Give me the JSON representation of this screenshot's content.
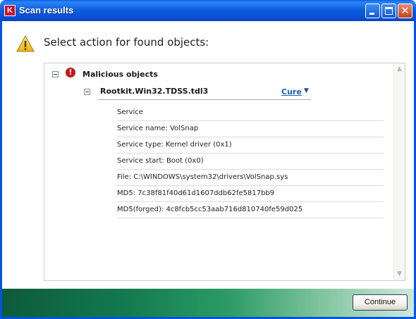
{
  "window": {
    "title": "Scan results",
    "app_icon": "kaspersky-k-icon",
    "controls": {
      "minimize": "minimize-icon",
      "maximize": "maximize-icon",
      "close": "close-icon"
    }
  },
  "header": {
    "icon": "warning-triangle-icon",
    "text": "Select action for found objects:"
  },
  "tree": {
    "group": {
      "label": "Malicious objects",
      "icon": "exclamation-circle-icon",
      "expanded": true
    },
    "threat": {
      "name": "Rootkit.Win32.TDSS.tdl3",
      "action_label": "Cure",
      "expanded": true
    },
    "details": [
      "Service",
      "Service name: VolSnap",
      "Service type: Kernel driver (0x1)",
      "Service start: Boot (0x0)",
      "File: C:\\WINDOWS\\system32\\drivers\\VolSnap.sys",
      "MD5: 7c38f81f40d61d1607ddb62fe5817bb9",
      "MD5(forged): 4c8fcb5cc53aab716d810740fe59d025"
    ]
  },
  "footer": {
    "continue_label": "Continue"
  },
  "colors": {
    "titlebar": "#0a4fd4",
    "link": "#1f5db5",
    "footer_green": "#137a4e"
  }
}
